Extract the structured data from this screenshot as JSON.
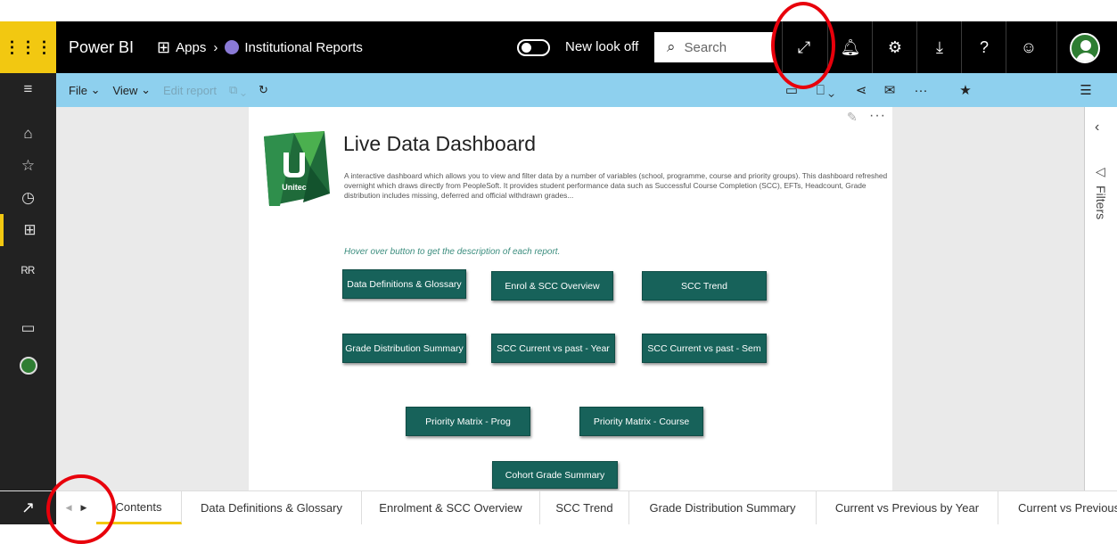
{
  "topbar": {
    "brand": "Power BI",
    "apps_label": "Apps",
    "app_initial": "R",
    "app_name": "Institutional Reports",
    "new_look_label": "New look off",
    "search_placeholder": "Search"
  },
  "actionbar": {
    "file_label": "File",
    "view_label": "View",
    "edit_label": "Edit report"
  },
  "report": {
    "logo_text": "Unitec",
    "title": "Live Data Dashboard",
    "description": "A interactive dashboard which allows you to view and filter data by a number of variables (school, programme, course and priority groups). This dashboard refreshed overnight which draws directly from PeopleSoft. It provides student performance data such as Successful Course Completion (SCC), EFTs, Headcount, Grade distribution includes missing, deferred and official withdrawn grades...",
    "hint": "Hover over button to get the description of each report.",
    "buttons": [
      "Data Definitions & Glossary",
      "Enrol & SCC Overview",
      "SCC Trend",
      "Grade Distribution Summary",
      "SCC Current vs past - Year",
      "SCC Current vs past - Sem",
      "Priority Matrix - Prog",
      "Priority Matrix - Course",
      "Cohort Grade Summary"
    ]
  },
  "filters": {
    "label": "Filters"
  },
  "tabs": [
    "Contents",
    "Data Definitions & Glossary",
    "Enrolment & SCC Overview",
    "SCC Trend",
    "Grade Distribution Summary",
    "Current vs Previous by Year",
    "Current vs Previous"
  ],
  "colors": {
    "brand_yellow": "#f2c811",
    "action_bar": "#8ed0ee",
    "report_button": "#17625a",
    "annotation_red": "#e8000b"
  }
}
